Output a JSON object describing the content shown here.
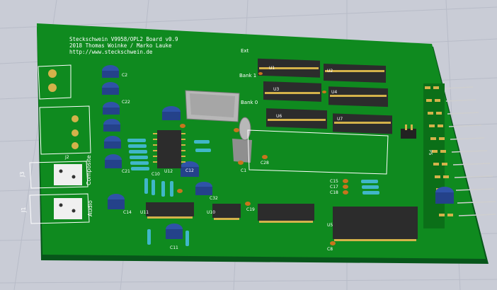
{
  "board": {
    "silkscreen_lines": [
      "Steckschwein V9958/OPL2 Board v0.9",
      "2018 Thomas Woinke / Marko Lauke",
      "http://www.steckschwein.de"
    ],
    "bank_labels": [
      "Ext",
      "Bank 1",
      "Bank 0"
    ],
    "connector_labels": [
      "Composite",
      "Audio",
      "J3",
      "J1",
      "J2",
      "P5"
    ],
    "refs": [
      "C1",
      "C2",
      "C8",
      "C10",
      "C11",
      "C12",
      "C14",
      "C15",
      "C17",
      "C18",
      "C19",
      "C21",
      "C22",
      "C28",
      "C32",
      "U1",
      "U2",
      "U3",
      "U4",
      "U5",
      "U6",
      "U7",
      "U10",
      "U11",
      "U12"
    ]
  },
  "colors": {
    "background": "#c9ccd6",
    "pcb": "#0f8a1f",
    "pcb_edge": "#07561a",
    "ic_body": "#2c2c2c",
    "pads": "#d4b24a",
    "silkscreen": "#ffffff",
    "electrolytic_cap": "#2f53a8",
    "resistor": "#40b7c8",
    "ceramic_cap": "#c8741d"
  }
}
